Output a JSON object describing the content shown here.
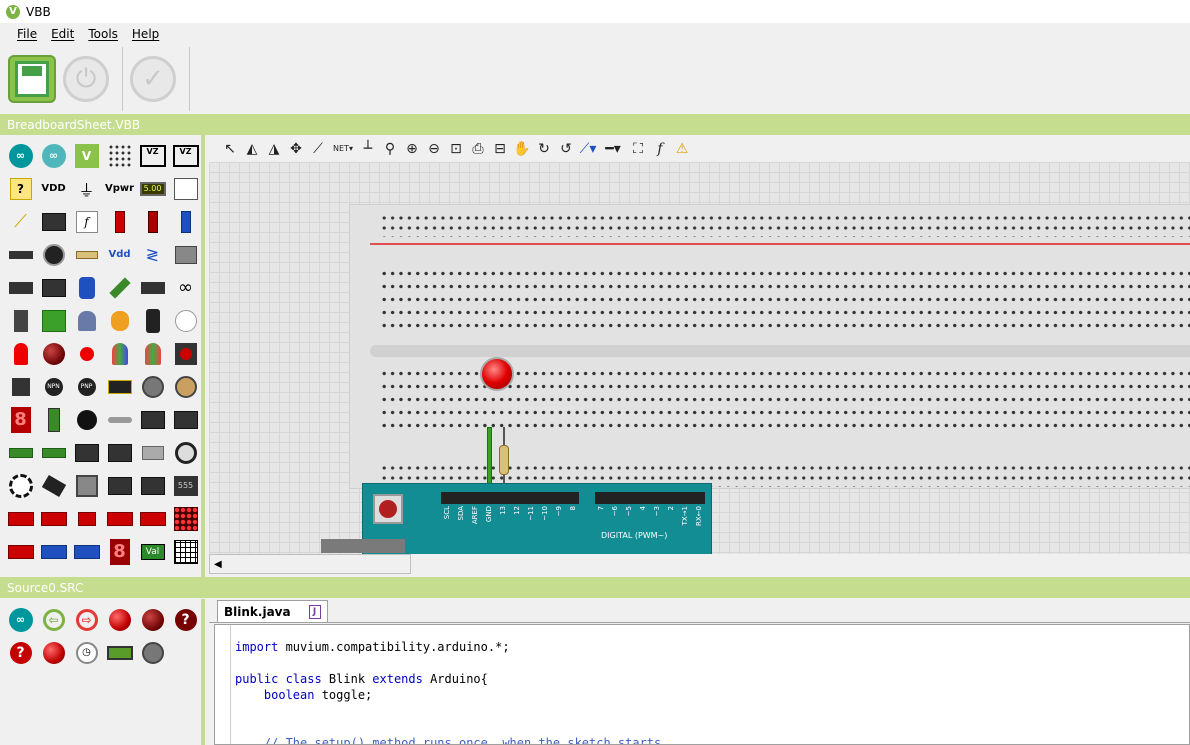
{
  "window": {
    "title": "VBB"
  },
  "menu": {
    "items": [
      "File",
      "Edit",
      "Tools",
      "Help"
    ]
  },
  "toolbar": {
    "save": "save",
    "power": "power",
    "verify": "verify"
  },
  "breadboard_panel": {
    "title": "BreadboardSheet.VBB"
  },
  "source_panel": {
    "title": "Source0.SRC"
  },
  "palette": {
    "vdd": "VDD",
    "vpwr": "Vpwr",
    "vdd2": "Vdd",
    "display": "5.00",
    "ic555": "555",
    "val": "Val",
    "seg": "8",
    "npn": "NPN",
    "pnp": "PNP"
  },
  "arduino": {
    "digital_label": "DIGITAL (PWM~)",
    "pins_left": [
      "SCL",
      "SDA",
      "AREF",
      "GND",
      "13",
      "12",
      "~11",
      "~10",
      "~9",
      "8"
    ],
    "pins_right": [
      "7",
      "~6",
      "~5",
      "4",
      "~3",
      "2",
      "TX→1",
      "RX←0"
    ]
  },
  "editor": {
    "tab_label": "Blink.java",
    "tab_close": "J",
    "code": {
      "line1_kw": "import",
      "line1_rest": " muvium.compatibility.arduino.*;",
      "line2_kw1": "public class",
      "line2_mid": " Blink ",
      "line2_kw2": "extends",
      "line2_rest": " Arduino{",
      "line3_kw": "boolean",
      "line3_rest": " toggle;",
      "line4_comment": "// The setup() method runs once, when the sketch starts"
    }
  }
}
